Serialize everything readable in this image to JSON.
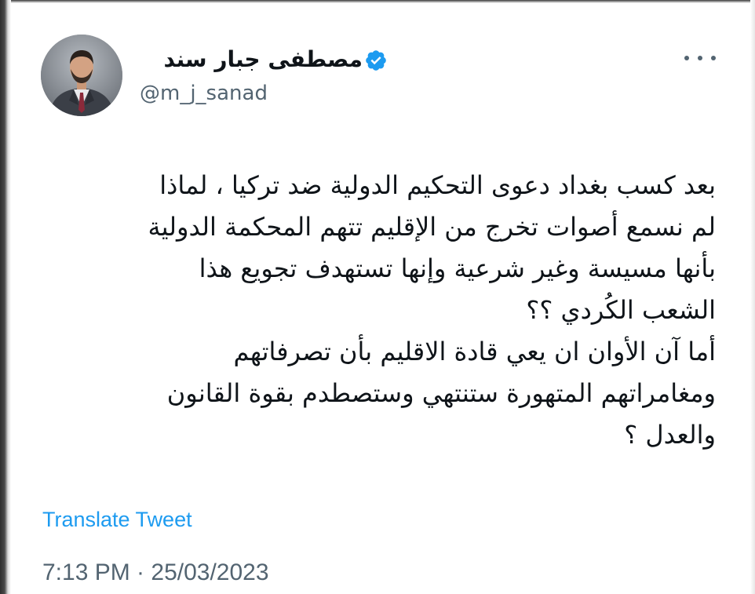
{
  "tweet": {
    "author": {
      "display_name": "مصطفى جبار سند",
      "handle": "@m_j_sanad",
      "verified": true,
      "avatar_icon": "profile-photo-man-in-suit"
    },
    "more_icon": "more-options-icon",
    "text_lines": [
      "بعد كسب بغداد دعوى التحكيم الدولية ضد تركيا ، لماذا",
      "لم نسمع أصوات تخرج من الإقليم تتهم المحكمة الدولية",
      "بأنها مسيسة وغير شرعية وإنها تستهدف تجويع هذا",
      "الشعب الكُردي ؟؟",
      "أما آن الأوان ان يعي قادة الاقليم بأن تصرفاتهم",
      "ومغامراتهم المتهورة ستنتهي وستصطدم بقوة القانون",
      "والعدل ؟"
    ],
    "translate_label": "Translate Tweet",
    "timestamp": "7:13 PM · 25/03/2023"
  },
  "colors": {
    "text": "#0f1419",
    "muted": "#536471",
    "accent": "#1d9bf0"
  }
}
